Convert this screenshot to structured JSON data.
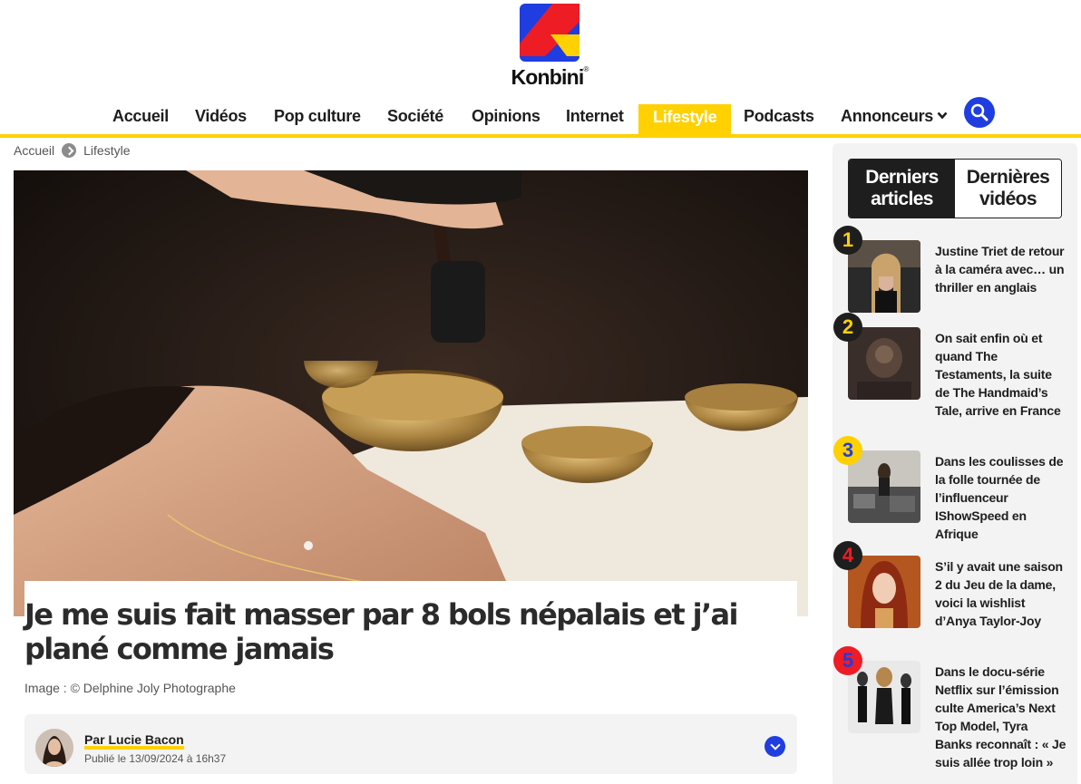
{
  "brand": {
    "name": "Konbini",
    "trademark": "®",
    "accent_yellow": "#ffd100",
    "accent_blue": "#1f3de0",
    "accent_red": "#ee1c25"
  },
  "nav": {
    "items": [
      {
        "label": "Accueil"
      },
      {
        "label": "Vidéos"
      },
      {
        "label": "Pop culture"
      },
      {
        "label": "Société"
      },
      {
        "label": "Opinions"
      },
      {
        "label": "Internet"
      },
      {
        "label": "Lifestyle",
        "active": true
      },
      {
        "label": "Podcasts"
      },
      {
        "label": "Annonceurs",
        "has_dropdown": true
      }
    ],
    "search_icon": "search-icon"
  },
  "breadcrumb": {
    "items": [
      "Accueil",
      "Lifestyle"
    ]
  },
  "article": {
    "title": "Je me suis fait masser par 8 bols népalais et j’ai plané comme jamais",
    "image_credit": "Image :  © Delphine Joly Photographe",
    "author": "Par Lucie Bacon",
    "published": "Publié le 13/09/2024 à 16h37"
  },
  "sidebar": {
    "tabs": [
      {
        "label": "Derniers articles",
        "active": true
      },
      {
        "label": "Dernières vidéos",
        "active": false
      }
    ],
    "items": [
      {
        "rank": "1",
        "rank_color": "#ffd100",
        "title": "Justine Triet de retour à la caméra avec… un thriller en anglais"
      },
      {
        "rank": "2",
        "rank_color": "#ffd100",
        "title": "On sait enfin où et quand The Testaments, la suite de The Handmaid’s Tale, arrive en France"
      },
      {
        "rank": "3",
        "rank_color": "#1f3de0",
        "title": "Dans les coulisses de la folle tournée de l’influenceur IShowSpeed en Afrique"
      },
      {
        "rank": "4",
        "rank_color": "#ee1c25",
        "title": "S’il y avait une saison 2 du Jeu de la dame, voici la wishlist d’Anya Taylor-Joy"
      },
      {
        "rank": "5",
        "rank_color": "#1f3de0",
        "title": "Dans le docu-série Netflix sur l’émission culte America’s Next Top Model, Tyra Banks reconnaît : « Je suis allée trop loin »"
      }
    ]
  }
}
